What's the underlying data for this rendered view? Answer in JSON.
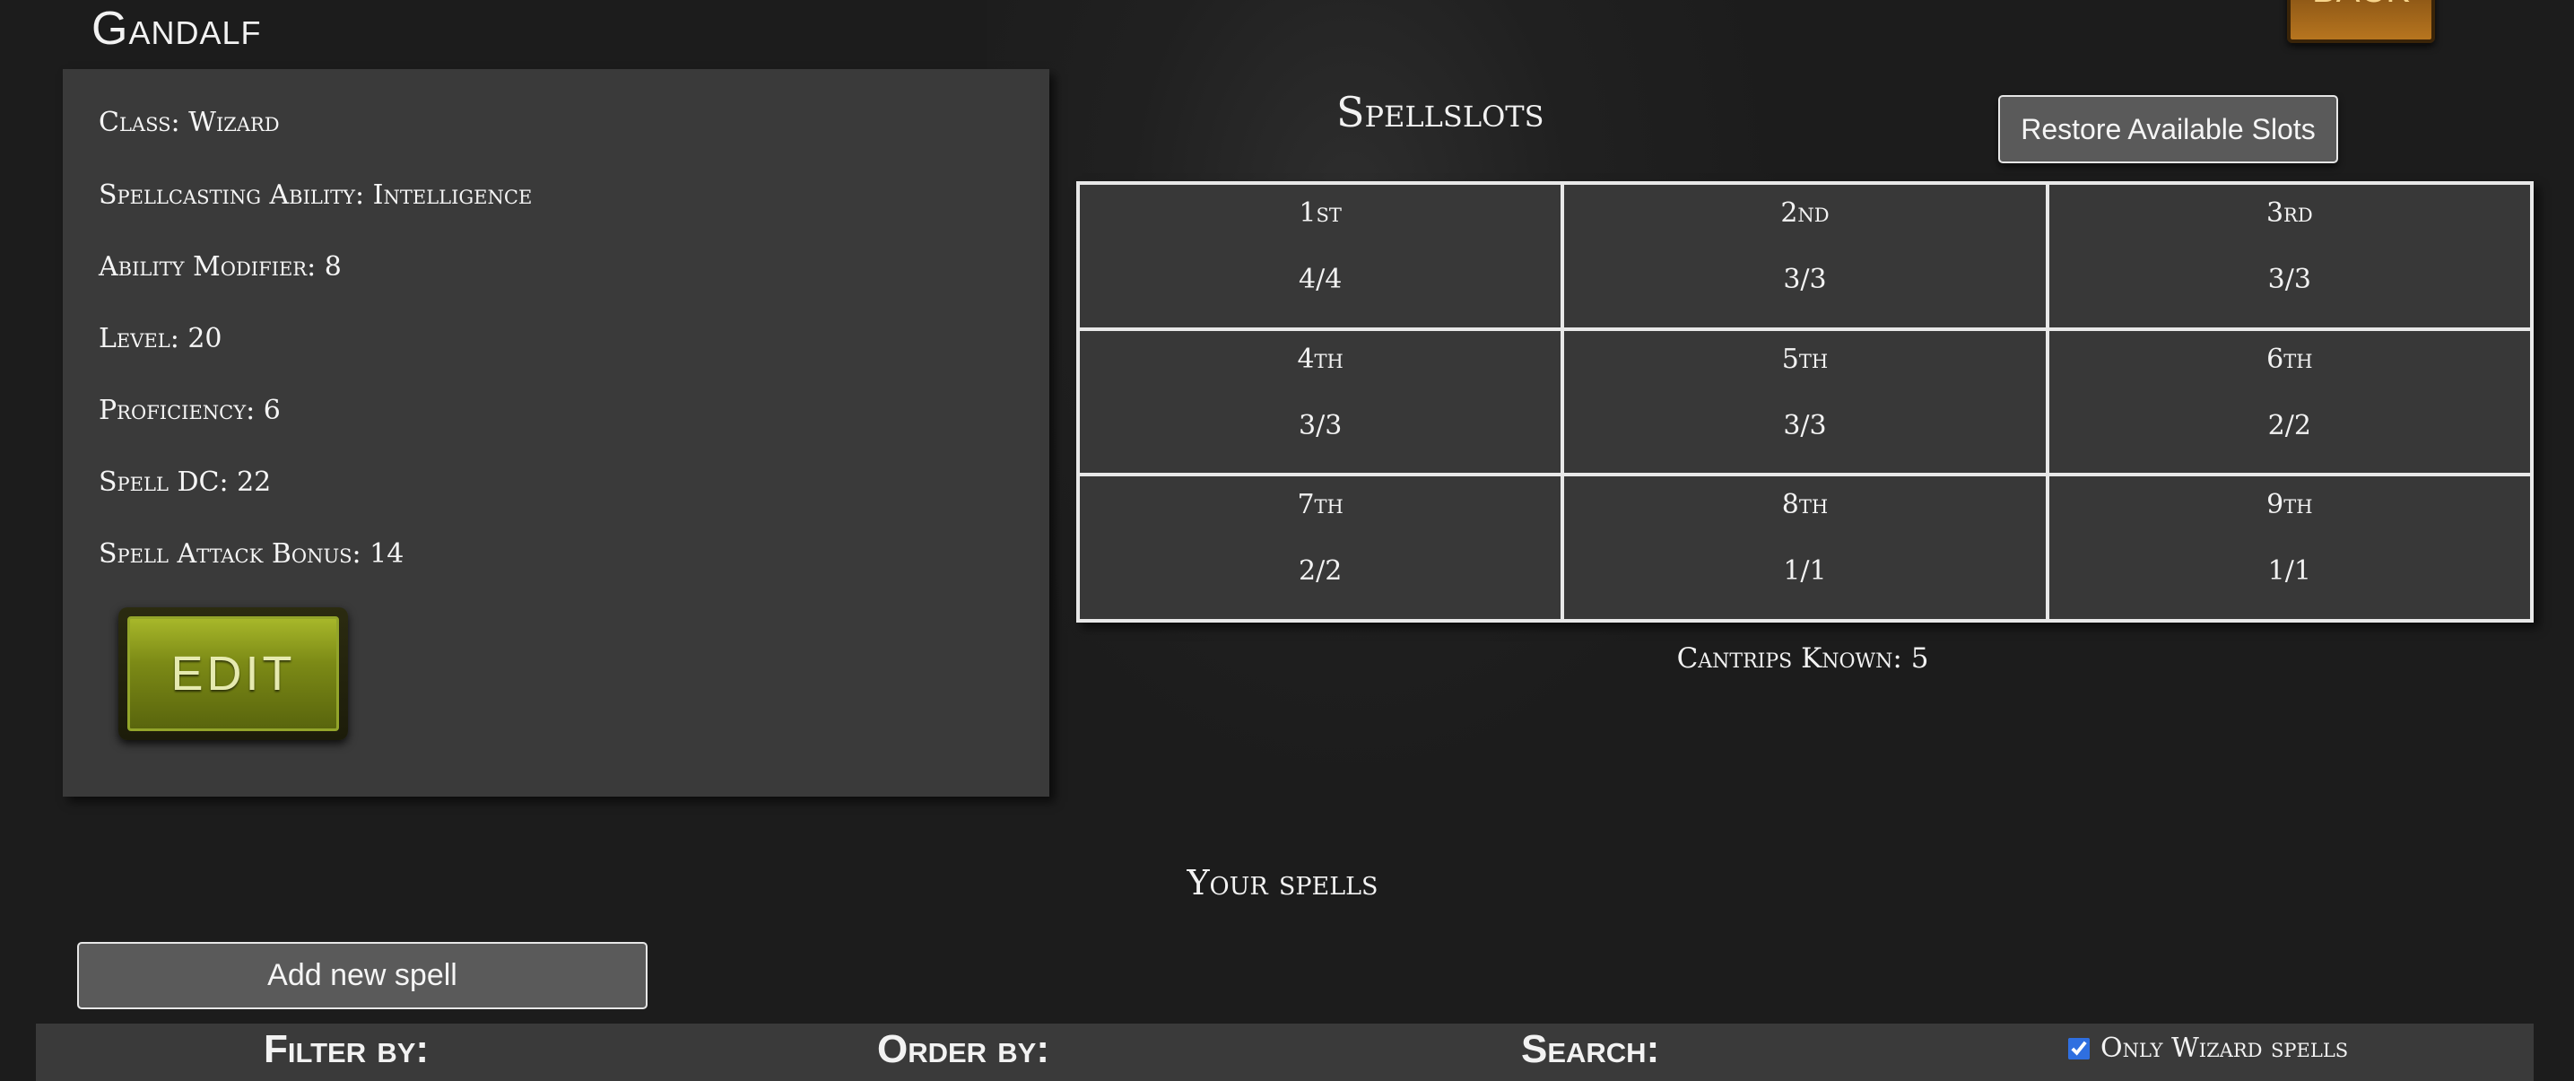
{
  "character": {
    "name": "Gandalf",
    "info": [
      "Class: Wizard",
      "Spellcasting Ability: Intelligence",
      "Ability Modifier: 8",
      "Level: 20",
      "Proficiency: 6",
      "Spell DC: 22",
      "Spell Attack Bonus: 14"
    ],
    "edit_label": "EDIT"
  },
  "header": {
    "back_label": "BACK"
  },
  "spellslots": {
    "title": "Spellslots",
    "restore_label": "Restore Available Slots",
    "slots": [
      {
        "level": "1st",
        "count": "4/4"
      },
      {
        "level": "2nd",
        "count": "3/3"
      },
      {
        "level": "3rd",
        "count": "3/3"
      },
      {
        "level": "4th",
        "count": "3/3"
      },
      {
        "level": "5th",
        "count": "3/3"
      },
      {
        "level": "6th",
        "count": "2/2"
      },
      {
        "level": "7th",
        "count": "2/2"
      },
      {
        "level": "8th",
        "count": "1/1"
      },
      {
        "level": "9th",
        "count": "1/1"
      }
    ],
    "cantrips_known": "Cantrips Known: 5"
  },
  "spells": {
    "heading": "Your spells",
    "add_label": "Add new spell",
    "filter_label": "Filter by:",
    "order_label": "Order by:",
    "search_label": "Search:",
    "only_class_label": "Only Wizard spells",
    "only_class_checked": true
  },
  "colors": {
    "background": "#1c1c1c",
    "panel": "#3a3a3a",
    "edit_button": "#7c8a16",
    "back_button": "#b7751f",
    "checkbox": "#2f6fe0"
  }
}
